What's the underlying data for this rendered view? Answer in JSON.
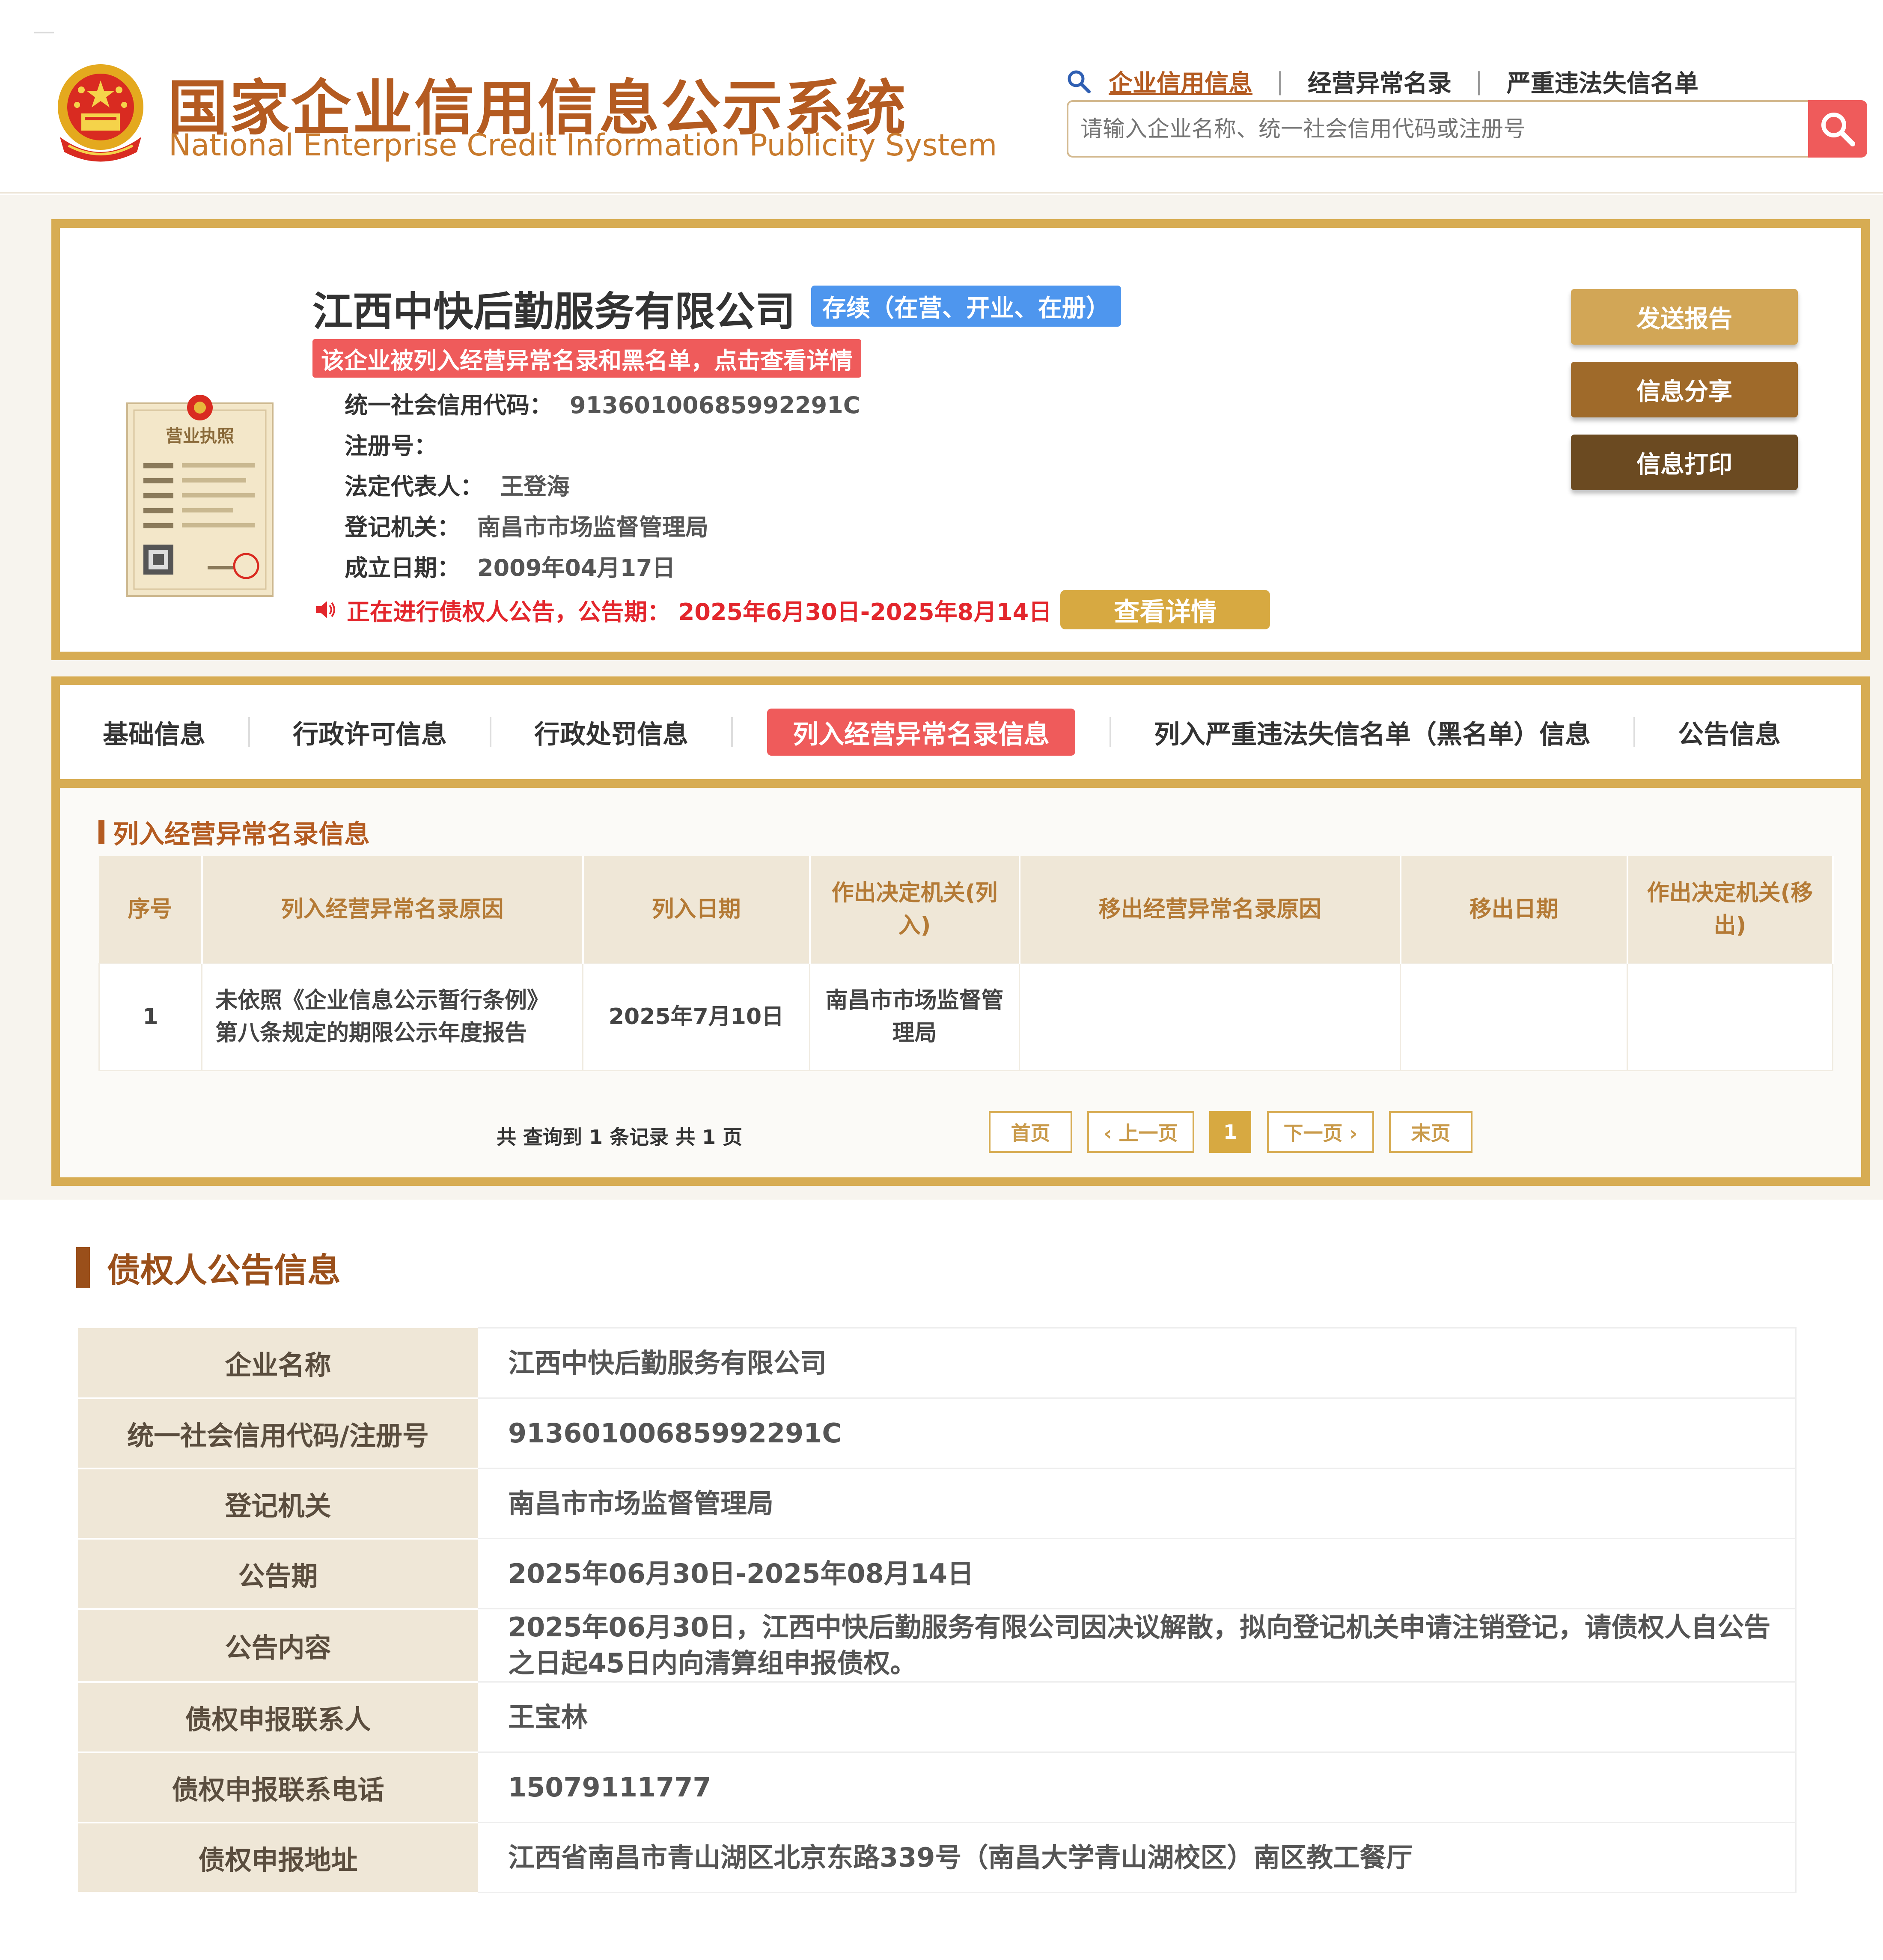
{
  "site": {
    "title": "国家企业信用信息公示系统",
    "subtitle": "National Enterprise Credit Information Publicity System"
  },
  "nav": {
    "credit_info": "企业信用信息",
    "abnormal_list": "经营异常名录",
    "blacklist": "严重违法失信名单",
    "separator": "|"
  },
  "search": {
    "placeholder": "请输入企业名称、统一社会信用代码或注册号"
  },
  "company": {
    "name": "江西中快后勤服务有限公司",
    "status": "存续（在营、开业、在册）",
    "warning": "该企业被列入经营异常名录和黑名单，点击查看详情",
    "fields": {
      "credit_code_label": "统一社会信用代码：",
      "credit_code": "91360100685992291C",
      "reg_no_label": "注册号：",
      "reg_no": "",
      "legal_rep_label": "法定代表人：",
      "legal_rep": "王登海",
      "authority_label": "登记机关：",
      "authority": "南昌市市场监督管理局",
      "founded_label": "成立日期：",
      "founded": "2009年04月17日"
    },
    "notice": "正在进行债权人公告，公告期： 2025年6月30日-2025年8月14日",
    "notice_button": "查看详情",
    "license_title": "营业执照"
  },
  "actions": {
    "send_report": "发送报告",
    "share": "信息分享",
    "print": "信息打印"
  },
  "tabs": [
    {
      "label": "基础信息"
    },
    {
      "label": "行政许可信息"
    },
    {
      "label": "行政处罚信息"
    },
    {
      "label": "列入经营异常名录信息",
      "active": true
    },
    {
      "label": "列入严重违法失信名单（黑名单）信息"
    },
    {
      "label": "公告信息"
    }
  ],
  "abnormal": {
    "section_title": "列入经营异常名录信息",
    "headers": [
      "序号",
      "列入经营异常名录原因",
      "列入日期",
      "作出决定机关(列入)",
      "移出经营异常名录原因",
      "移出日期",
      "作出决定机关(移出)"
    ],
    "rows": [
      [
        "1",
        "未依照《企业信息公示暂行条例》第八条规定的期限公示年度报告",
        "2025年7月10日",
        "南昌市市场监督管理局",
        "",
        "",
        ""
      ]
    ],
    "summary": "共 查询到 1 条记录 共 1 页",
    "pager": {
      "first": "首页",
      "prev": "‹ 上一页",
      "current": "1",
      "next": "下一页 ›",
      "last": "末页"
    }
  },
  "creditor": {
    "section_title": "债权人公告信息",
    "rows": [
      {
        "label": "企业名称",
        "value": "江西中快后勤服务有限公司"
      },
      {
        "label": "统一社会信用代码/注册号",
        "value": "91360100685992291C"
      },
      {
        "label": "登记机关",
        "value": "南昌市市场监督管理局"
      },
      {
        "label": "公告期",
        "value": "2025年06月30日-2025年08月14日"
      },
      {
        "label": "公告内容",
        "value": "2025年06月30日，江西中快后勤服务有限公司因决议解散，拟向登记机关申请注销登记，请债权人自公告之日起45日内向清算组申报债权。"
      },
      {
        "label": "债权申报联系人",
        "value": "王宝林"
      },
      {
        "label": "债权申报联系电话",
        "value": "15079111777"
      },
      {
        "label": "债权申报地址",
        "value": "江西省南昌市青山湖区北京东路339号（南昌大学青山湖校区）南区教工餐厅"
      }
    ]
  },
  "colors": {
    "brand_brown": "#b45b21",
    "gold": "#d7ac53",
    "alert_red": "#ef5b5b",
    "status_blue": "#4e96ee"
  }
}
